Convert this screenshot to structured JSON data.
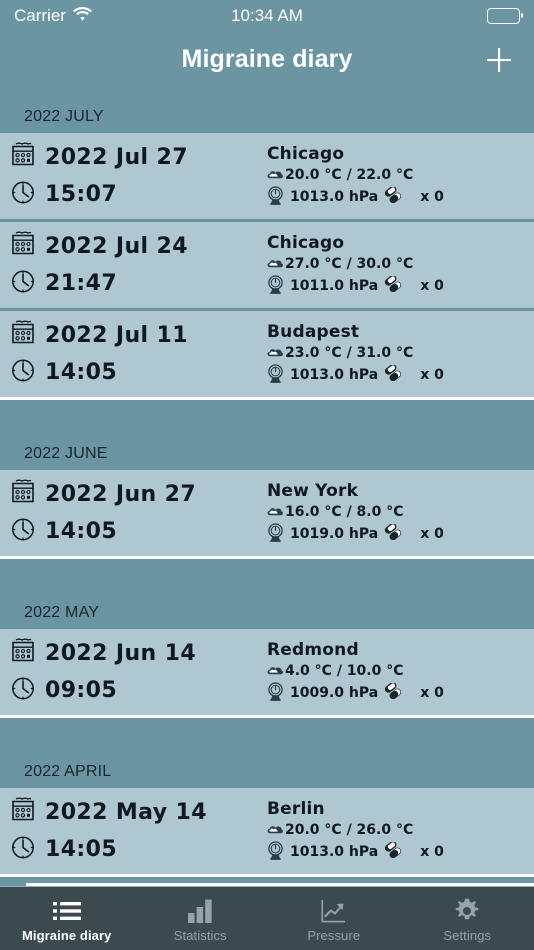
{
  "status_bar": {
    "carrier": "Carrier",
    "wifi_icon": "wifi-icon",
    "time": "10:34 AM",
    "battery_icon": "battery-full-icon"
  },
  "navbar": {
    "title": "Migraine diary",
    "add_button_icon": "plus-icon"
  },
  "colors": {
    "header_bg": "#6b95a3",
    "row_bg": "#aec7d0",
    "tabbar_bg": "#3c4a4f",
    "text_dark": "#101820",
    "text_white": "#ffffff",
    "tab_inactive": "#96a3a7"
  },
  "sections": [
    {
      "title": "2022 JULY",
      "entries": [
        {
          "date": "2022 Jul 27",
          "time": "15:07",
          "city": "Chicago",
          "temperature": "20.0 °C / 22.0 °C",
          "pressure": "1013.0 hPa",
          "pills": "x 0",
          "calendar_icon": "calendar-icon",
          "clock_icon": "clock-icon",
          "weather_icon": "cloud-icon",
          "pressure_icon": "barometer-icon",
          "pill_icon": "pill-icon"
        },
        {
          "date": "2022 Jul 24",
          "time": "21:47",
          "city": "Chicago",
          "temperature": "27.0 °C / 30.0 °C",
          "pressure": "1011.0 hPa",
          "pills": "x 0",
          "calendar_icon": "calendar-icon",
          "clock_icon": "clock-icon",
          "weather_icon": "cloud-icon",
          "pressure_icon": "barometer-icon",
          "pill_icon": "pill-icon"
        },
        {
          "date": "2022 Jul 11",
          "time": "14:05",
          "city": "Budapest",
          "temperature": "23.0 °C / 31.0 °C",
          "pressure": "1013.0 hPa",
          "pills": "x 0",
          "calendar_icon": "calendar-icon",
          "clock_icon": "clock-icon",
          "weather_icon": "cloud-icon",
          "pressure_icon": "barometer-icon",
          "pill_icon": "pill-icon"
        }
      ]
    },
    {
      "title": "2022 JUNE",
      "entries": [
        {
          "date": "2022 Jun 27",
          "time": "14:05",
          "city": "New York",
          "temperature": "16.0 °C / 8.0 °C",
          "pressure": "1019.0 hPa",
          "pills": "x 0",
          "calendar_icon": "calendar-icon",
          "clock_icon": "clock-icon",
          "weather_icon": "cloud-icon",
          "pressure_icon": "barometer-icon",
          "pill_icon": "pill-icon"
        }
      ]
    },
    {
      "title": "2022 MAY",
      "entries": [
        {
          "date": "2022 Jun 14",
          "time": "09:05",
          "city": "Redmond",
          "temperature": "4.0 °C / 10.0 °C",
          "pressure": "1009.0 hPa",
          "pills": "x 0",
          "calendar_icon": "calendar-icon",
          "clock_icon": "clock-icon",
          "weather_icon": "cloud-icon",
          "pressure_icon": "barometer-icon",
          "pill_icon": "pill-icon"
        }
      ]
    },
    {
      "title": "2022 APRIL",
      "entries": [
        {
          "date": "2022 May 14",
          "time": "14:05",
          "city": "Berlin",
          "temperature": "20.0 °C / 26.0 °C",
          "pressure": "1013.0 hPa",
          "pills": "x 0",
          "calendar_icon": "calendar-icon",
          "clock_icon": "clock-icon",
          "weather_icon": "cloud-icon",
          "pressure_icon": "barometer-icon",
          "pill_icon": "pill-icon"
        }
      ]
    }
  ],
  "tabbar": {
    "tabs": [
      {
        "label": "Migraine diary",
        "icon": "list-icon",
        "active": true
      },
      {
        "label": "Statistics",
        "icon": "bar-chart-icon",
        "active": false
      },
      {
        "label": "Pressure",
        "icon": "line-chart-icon",
        "active": false
      },
      {
        "label": "Settings",
        "icon": "gear-icon",
        "active": false
      }
    ]
  }
}
